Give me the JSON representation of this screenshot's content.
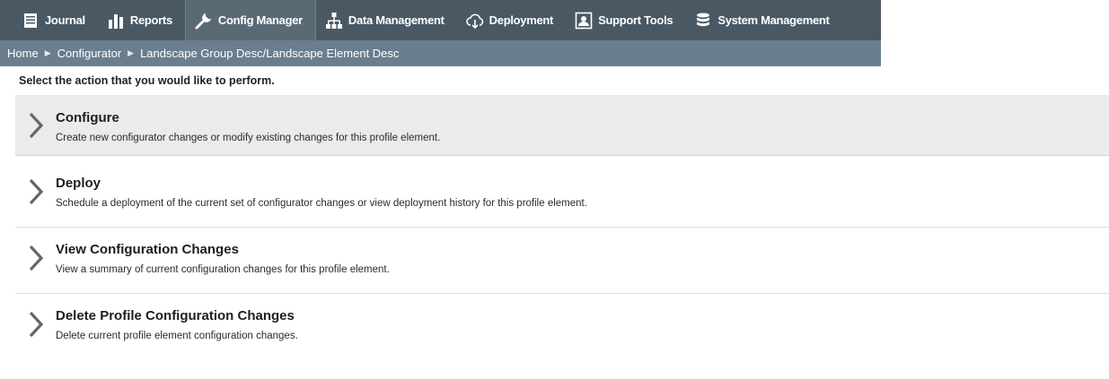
{
  "nav": {
    "items": [
      {
        "label": "Journal",
        "icon": "journal-icon"
      },
      {
        "label": "Reports",
        "icon": "bar-chart-icon"
      },
      {
        "label": "Config Manager",
        "icon": "wrench-icon"
      },
      {
        "label": "Data Management",
        "icon": "hierarchy-icon"
      },
      {
        "label": "Deployment",
        "icon": "cloud-download-icon"
      },
      {
        "label": "Support Tools",
        "icon": "support-user-icon"
      },
      {
        "label": "System Management",
        "icon": "database-icon"
      }
    ],
    "active": "Config Manager",
    "background": "#4a5863"
  },
  "breadcrumb": {
    "items": [
      "Home",
      "Configurator",
      "Landscape Group Desc/Landscape Element Desc"
    ],
    "background": "#6a7e8d"
  },
  "instructions": "Select the action that you would like to perform.",
  "actions": [
    {
      "title": "Configure",
      "description": "Create new configurator changes or modify existing changes for this profile element."
    },
    {
      "title": "Deploy",
      "description": "Schedule a deployment of the current set of configurator changes or view deployment history for this profile element."
    },
    {
      "title": "View Configuration Changes",
      "description": "View a summary of current configuration changes for this profile element."
    },
    {
      "title": "Delete Profile Configuration Changes",
      "description": "Delete current profile element configuration changes."
    }
  ]
}
